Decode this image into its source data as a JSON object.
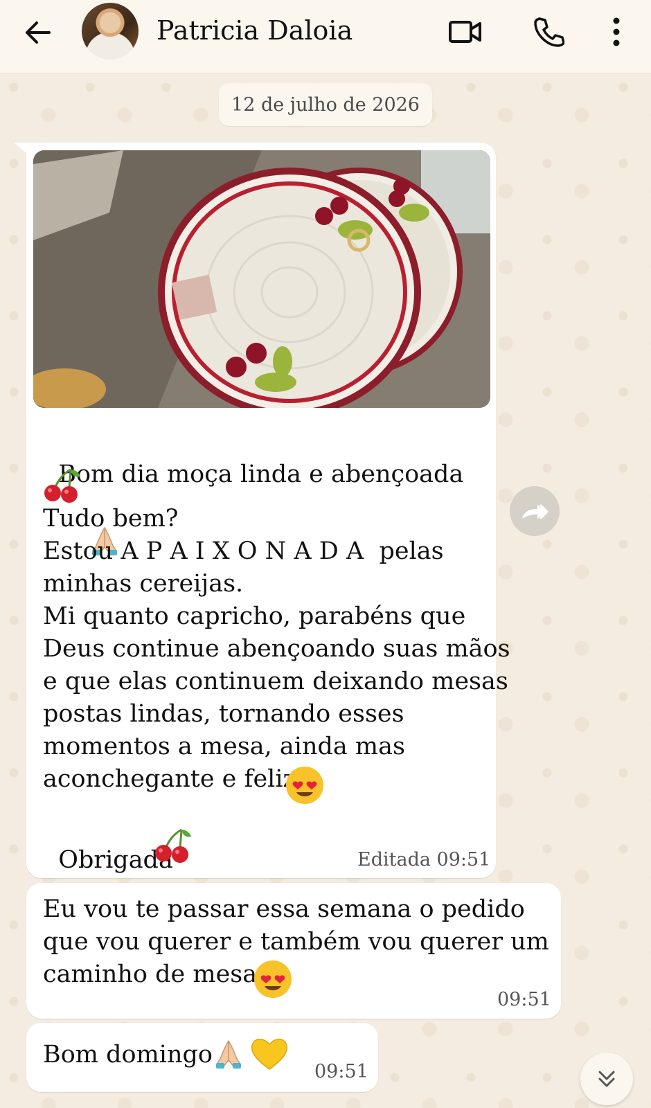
{
  "header": {
    "contact_name": "Patricia Daloia",
    "icons": [
      "back-arrow-icon",
      "video-call-icon",
      "voice-call-icon",
      "more-options-icon"
    ]
  },
  "date_chip": "12 de julho de 2026",
  "messages": [
    {
      "has_image": true,
      "image_description_icon": "crochet-placemat-photo",
      "text_line_1": "Bom dia moça linda e abençoada",
      "text_rest": "Tudo bem?\nEstou A P A I X O N A D A  pelas\nminhas cereijas.\nMi quanto capricho, parabéns que\nDeus continue abençoando suas mãos\ne que elas continuem deixando mesas\npostas lindas, tornando esses\nmomentos a mesa, ainda mas\naconchegante e feliz",
      "closing": "Obrigada",
      "meta": "Editada 09:51"
    },
    {
      "text": "Eu vou te passar essa semana o pedido\nque vou querer e também vou querer um\ncaminho de mesa",
      "time": "09:51"
    },
    {
      "text": "Bom domingo",
      "time": "09:51"
    }
  ],
  "colors": {
    "header_bg": "#fbf6ee",
    "chat_bg": "#f4ece0",
    "bubble": "#ffffff"
  }
}
